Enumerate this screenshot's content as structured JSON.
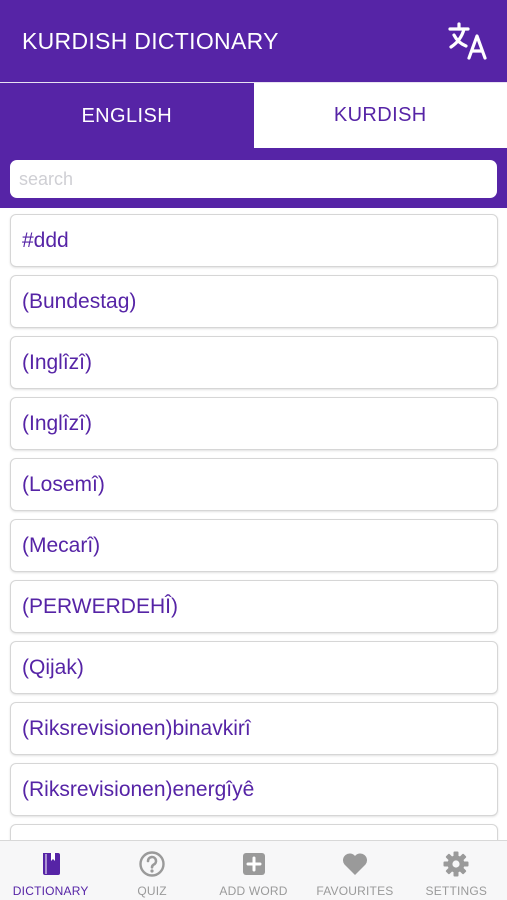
{
  "header": {
    "title": "KURDISH DICTIONARY",
    "translate_icon": "translate-icon"
  },
  "tabs": [
    {
      "label": "ENGLISH",
      "active": false
    },
    {
      "label": "KURDISH",
      "active": true
    }
  ],
  "search": {
    "placeholder": "search",
    "value": ""
  },
  "words": [
    "#ddd",
    "(Bundestag)",
    "(Inglîzî)",
    "(Inglîzî)",
    "(Losemî)",
    "(Mecarî)",
    "(PERWERDEHÎ)",
    "(Qijak)",
    "(Riksrevisionen)binavkirî",
    "(Riksrevisionen)energîyê",
    ""
  ],
  "bottom_nav": [
    {
      "label": "DICTIONARY",
      "icon": "book-icon",
      "active": true
    },
    {
      "label": "QUIZ",
      "icon": "question-circle-icon",
      "active": false
    },
    {
      "label": "ADD WORD",
      "icon": "plus-square-icon",
      "active": false
    },
    {
      "label": "FAVOURITES",
      "icon": "heart-icon",
      "active": false
    },
    {
      "label": "SETTINGS",
      "icon": "gear-icon",
      "active": false
    }
  ],
  "colors": {
    "primary": "#5624a6",
    "inactive": "#9a9a9a",
    "background": "#ffffff"
  }
}
